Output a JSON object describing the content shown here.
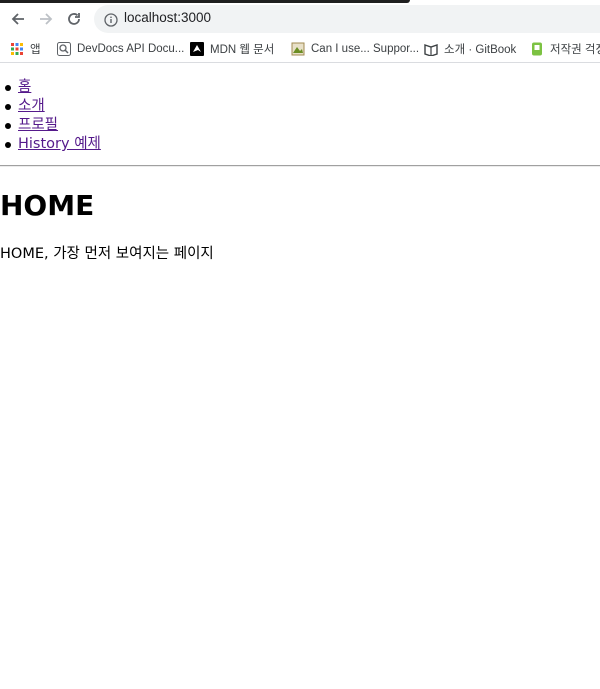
{
  "browser": {
    "url": "localhost:3000",
    "bookmarks": [
      {
        "label": "앱",
        "icon": "apps-grid-icon"
      },
      {
        "label": "DevDocs API Docu...",
        "icon": "devdocs-icon"
      },
      {
        "label": "MDN 웹 문서",
        "icon": "mdn-icon"
      },
      {
        "label": "Can I use... Suppor...",
        "icon": "caniuse-icon"
      },
      {
        "label": "소개 · GitBook",
        "icon": "gitbook-icon"
      },
      {
        "label": "저작권 걱정",
        "icon": "copyright-icon"
      }
    ]
  },
  "nav": {
    "items": [
      {
        "label": "홈"
      },
      {
        "label": "소개"
      },
      {
        "label": "프로필"
      },
      {
        "label": "History 예제"
      }
    ]
  },
  "content": {
    "title": "HOME",
    "description": "HOME, 가장 먼저 보여지는 페이지"
  }
}
